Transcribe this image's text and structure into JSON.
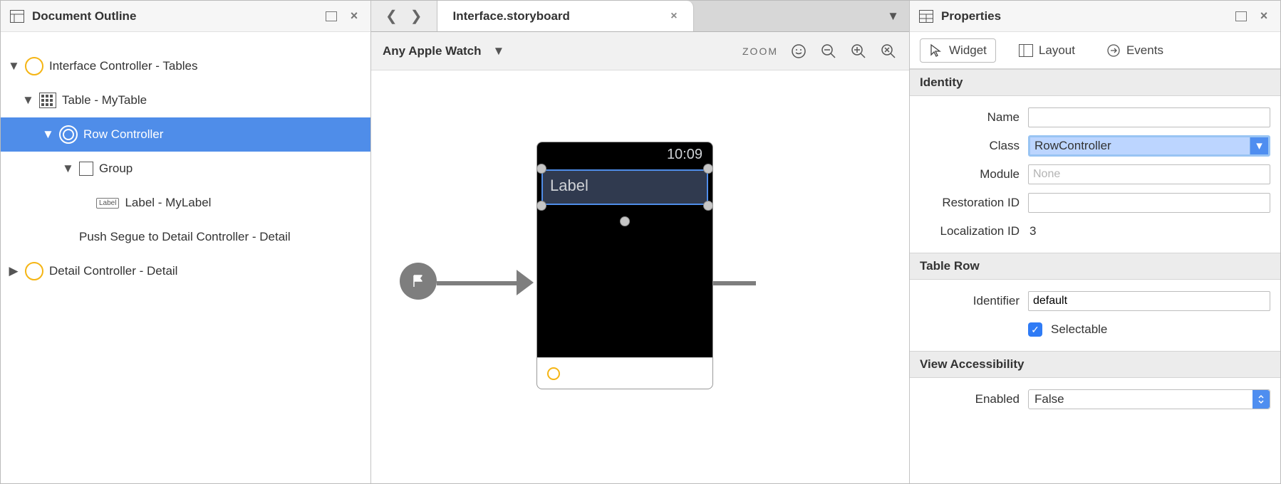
{
  "left": {
    "title": "Document Outline",
    "items": {
      "interface_controller": "Interface Controller - Tables",
      "table": "Table - MyTable",
      "row_controller": "Row Controller",
      "group": "Group",
      "label": "Label - MyLabel",
      "segue": "Push Segue to Detail Controller - Detail",
      "detail_controller": "Detail Controller - Detail"
    }
  },
  "center": {
    "tab_title": "Interface.storyboard",
    "device": "Any Apple Watch",
    "zoom_label": "ZOOM",
    "watch_time": "10:09",
    "row_label": "Label"
  },
  "right": {
    "title": "Properties",
    "tabs": {
      "widget": "Widget",
      "layout": "Layout",
      "events": "Events"
    },
    "sections": {
      "identity": "Identity",
      "table_row": "Table Row",
      "view_accessibility": "View Accessibility"
    },
    "identity": {
      "name_label": "Name",
      "name_value": "",
      "class_label": "Class",
      "class_value": "RowController",
      "module_label": "Module",
      "module_placeholder": "None",
      "restoration_label": "Restoration ID",
      "restoration_value": "",
      "localization_label": "Localization ID",
      "localization_value": "3"
    },
    "table_row": {
      "identifier_label": "Identifier",
      "identifier_value": "default",
      "selectable_label": "Selectable"
    },
    "accessibility": {
      "enabled_label": "Enabled",
      "enabled_value": "False"
    }
  }
}
